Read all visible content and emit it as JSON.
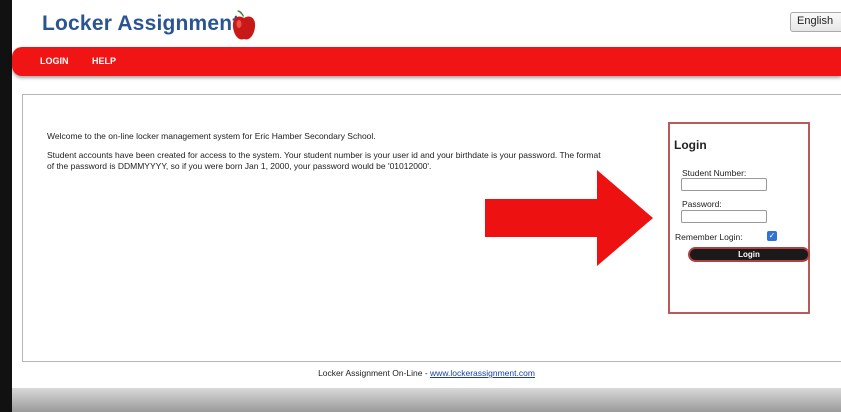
{
  "header": {
    "title": "Locker Assignment",
    "language": "English"
  },
  "nav": {
    "items": [
      "LOGIN",
      "HELP"
    ]
  },
  "welcome": {
    "line1": "Welcome to the on-line locker management system for Eric Hamber Secondary School.",
    "line2": "Student accounts have been created for access to the system. Your student number is your user id and your birthdate is your password. The format of the password is DDMMYYYY, so if you were born Jan 1, 2000, your password would be '01012000'."
  },
  "login": {
    "title": "Login",
    "student_label": "Student Number:",
    "password_label": "Password:",
    "remember_label": "Remember Login:",
    "remember_checked": true,
    "button": "Login"
  },
  "footer": {
    "text": "Locker Assignment On-Line - ",
    "link": "www.lockerassignment.com"
  },
  "colors": {
    "nav": "#f01414",
    "title": "#2a5592",
    "arrow": "#ee1111",
    "panel_border": "#b85a5a"
  }
}
